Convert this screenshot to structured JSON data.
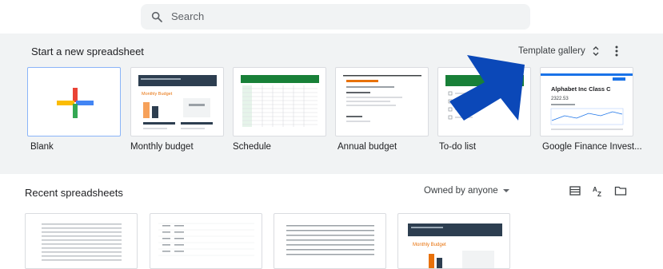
{
  "search": {
    "placeholder": "Search"
  },
  "templates": {
    "title": "Start a new spreadsheet",
    "gallery_label": "Template gallery",
    "items": [
      {
        "label": "Blank"
      },
      {
        "label": "Monthly budget"
      },
      {
        "label": "Schedule"
      },
      {
        "label": "Annual budget"
      },
      {
        "label": "To-do list"
      },
      {
        "label": "Google Finance Invest..."
      }
    ],
    "thumbnails": {
      "monthly": {
        "heading": "Monthly Budget"
      },
      "finance": {
        "heading": "Alphabet Inc Class C",
        "price": "2322.53"
      }
    }
  },
  "recent": {
    "title": "Recent spreadsheets",
    "owner_filter": "Owned by anyone",
    "thumb_heading": "Monthly Budget"
  },
  "colors": {
    "brand_green": "#188038",
    "accent_blue": "#1a73e8",
    "arrow_blue": "#0b48b8",
    "orange": "#e8710a",
    "navy": "#2d3e50"
  }
}
